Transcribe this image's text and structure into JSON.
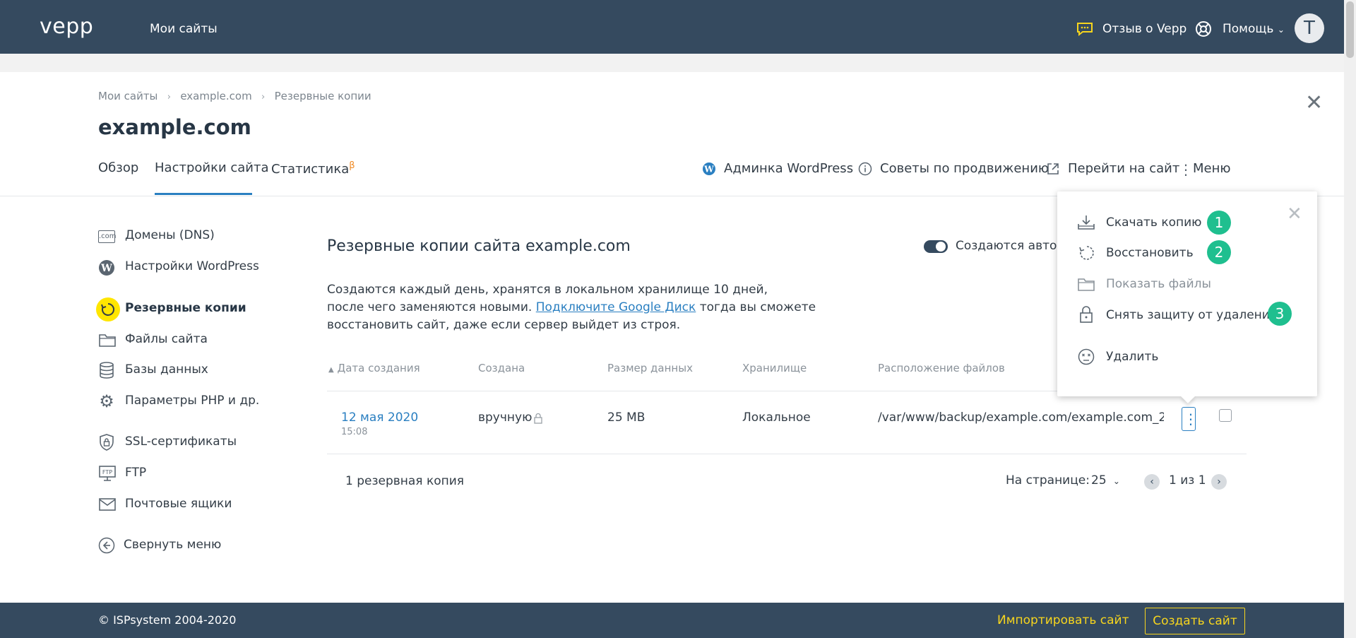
{
  "topbar": {
    "logo": "vepp",
    "my_sites": "Мои сайты",
    "feedback": "Отзыв о Vepp",
    "help": "Помощь",
    "avatar_letter": "T"
  },
  "breadcrumb": [
    "Мои сайты",
    "example.com",
    "Резервные копии"
  ],
  "site_title": "example.com",
  "tabs": {
    "overview": "Обзор",
    "settings": "Настройки сайта",
    "stats": "Статистика",
    "stats_sup": "β"
  },
  "actions": {
    "wp_admin": "Админка WordPress",
    "tips": "Советы по продвижению",
    "go_site": "Перейти на сайт",
    "menu": "Меню"
  },
  "sidebar": {
    "items": [
      {
        "label": "Домены (DNS)",
        "icon": "domain-icon"
      },
      {
        "label": "Настройки WordPress",
        "icon": "wordpress-icon"
      },
      {
        "label": "Резервные копии",
        "icon": "backup-icon"
      },
      {
        "label": "Файлы сайта",
        "icon": "folder-icon"
      },
      {
        "label": "Базы данных",
        "icon": "database-icon"
      },
      {
        "label": "Параметры PHP и др.",
        "icon": "gear-icon"
      },
      {
        "label": "SSL-сертификаты",
        "icon": "shield-icon"
      },
      {
        "label": "FTP",
        "icon": "ftp-icon"
      },
      {
        "label": "Почтовые ящики",
        "icon": "mail-icon"
      }
    ],
    "collapse": "Свернуть меню"
  },
  "main": {
    "title": "Резервные копии сайта example.com",
    "toggle_label": "Создаются автом",
    "desc_line1": "Создаются каждый день, хранятся в локальном хранилище 10 дней,",
    "desc_pre": "после чего заменяются новыми. ",
    "desc_link": "Подключите Google Диск",
    "desc_post": " тогда вы сможете",
    "desc_line3": "восстановить сайт, даже если сервер выйдет из строя."
  },
  "table": {
    "headers": [
      "Дата создания",
      "Создана",
      "Размер данных",
      "Хранилище",
      "Расположение файлов"
    ],
    "sort_arrow": "▲",
    "row": {
      "date": "12 мая 2020",
      "time": "15:08",
      "created": "вручную",
      "size": "25 MB",
      "storage": "Локальное",
      "path": "/var/www/backup/example.com/example.com_2..."
    },
    "count": "1 резервная копия",
    "per_page_label": "На странице:",
    "per_page_value": "25",
    "page_info": "1 из 1"
  },
  "dropdown": {
    "items": [
      {
        "label": "Скачать копию",
        "badge": "1"
      },
      {
        "label": "Восстановить",
        "badge": "2"
      },
      {
        "label": "Показать файлы"
      },
      {
        "label": "Снять защиту от удаления",
        "badge": "3"
      },
      {
        "label": "Удалить"
      }
    ]
  },
  "footer": {
    "copyright": "© ISPsystem 2004-2020",
    "import": "Импортировать сайт",
    "create": "Создать сайт"
  },
  "colors": {
    "topbar": "#354a5f",
    "accent": "#2a7fc1",
    "badge": "#1fbf8f",
    "highlight": "#ffe600",
    "footer_link": "#f7d51d"
  }
}
